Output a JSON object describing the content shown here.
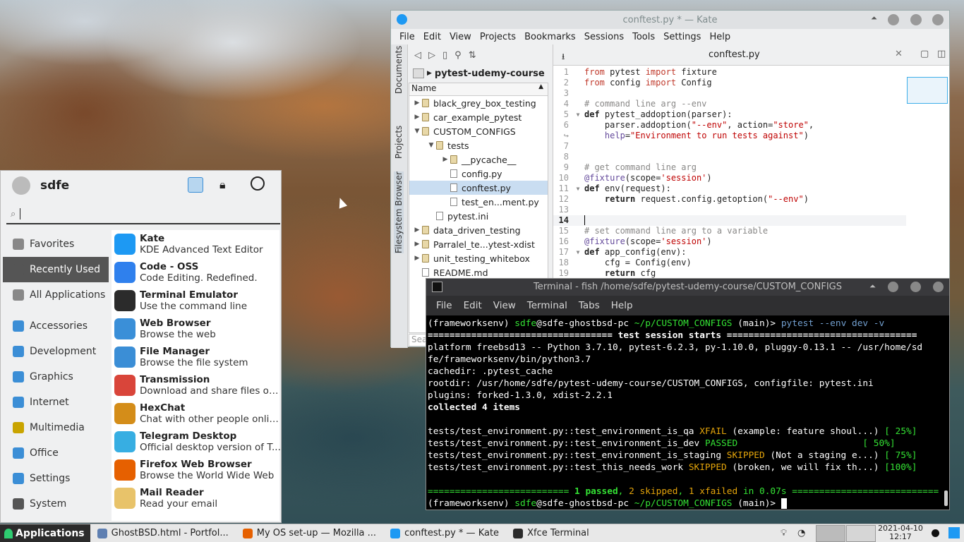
{
  "kate": {
    "title": "conftest.py * — Kate",
    "menu": [
      "File",
      "Edit",
      "View",
      "Projects",
      "Bookmarks",
      "Sessions",
      "Tools",
      "Settings",
      "Help"
    ],
    "side_tabs": [
      "Documents",
      "Projects",
      "Filesystem Browser"
    ],
    "crumb": "pytest-udemy-course",
    "tree_header": "Name",
    "tree": [
      {
        "label": "black_grey_box_testing",
        "type": "folder",
        "depth": 0,
        "arrow": "▶"
      },
      {
        "label": "car_example_pytest",
        "type": "folder",
        "depth": 0,
        "arrow": "▶"
      },
      {
        "label": "CUSTOM_CONFIGS",
        "type": "folder",
        "depth": 0,
        "arrow": "▼"
      },
      {
        "label": "tests",
        "type": "folder",
        "depth": 1,
        "arrow": "▼"
      },
      {
        "label": "__pycache__",
        "type": "folder",
        "depth": 2,
        "arrow": "▶"
      },
      {
        "label": "config.py",
        "type": "file",
        "depth": 2,
        "arrow": ""
      },
      {
        "label": "conftest.py",
        "type": "file",
        "depth": 2,
        "arrow": "",
        "selected": true
      },
      {
        "label": "test_en...ment.py",
        "type": "file",
        "depth": 2,
        "arrow": ""
      },
      {
        "label": "pytest.ini",
        "type": "file",
        "depth": 1,
        "arrow": ""
      },
      {
        "label": "data_driven_testing",
        "type": "folder",
        "depth": 0,
        "arrow": "▶"
      },
      {
        "label": "Parralel_te...ytest-xdist",
        "type": "folder",
        "depth": 0,
        "arrow": "▶"
      },
      {
        "label": "unit_testing_whitebox",
        "type": "folder",
        "depth": 0,
        "arrow": "▶"
      },
      {
        "label": "README.md",
        "type": "file",
        "depth": 0,
        "arrow": ""
      }
    ],
    "search_placeholder": "Sea",
    "tab": "conftest.py",
    "code_lines": [
      {
        "n": "1",
        "html": "<span class='k2'>from</span> pytest <span class='k2'>import</span> fixture"
      },
      {
        "n": "2",
        "html": "<span class='k2'>from</span> config <span class='k2'>import</span> Config"
      },
      {
        "n": "3",
        "html": ""
      },
      {
        "n": "4",
        "html": "<span class='cm'># command line arg --env</span>"
      },
      {
        "n": "5",
        "html": "<b>def</b> pytest_addoption(parser):",
        "fold": true
      },
      {
        "n": "6",
        "html": "    parser.addoption(<span class='st'>\"--env\"</span>, action=<span class='st'>\"store\"</span>,"
      },
      {
        "n": "↪",
        "html": "    <span class='hp'>help</span>=<span class='st'>\"Environment to run tests against\"</span>)"
      },
      {
        "n": "7",
        "html": ""
      },
      {
        "n": "8",
        "html": ""
      },
      {
        "n": "9",
        "html": "<span class='cm'># get command line arg</span>"
      },
      {
        "n": "10",
        "html": "<span class='dec'>@fixture</span>(scope=<span class='st'>'session'</span>)"
      },
      {
        "n": "11",
        "html": "<b>def</b> env(request):",
        "fold": true
      },
      {
        "n": "12",
        "html": "    <b>return</b> request.config.getoption(<span class='st'>\"--env\"</span>)"
      },
      {
        "n": "13",
        "html": ""
      },
      {
        "n": "14",
        "html": "",
        "cur": true
      },
      {
        "n": "15",
        "html": "<span class='cm'># set command line arg to a variable</span>"
      },
      {
        "n": "16",
        "html": "<span class='dec'>@fixture</span>(scope=<span class='st'>'session'</span>)"
      },
      {
        "n": "17",
        "html": "<b>def</b> app_config(env):",
        "fold": true
      },
      {
        "n": "18",
        "html": "    cfg = Config(env)"
      },
      {
        "n": "19",
        "html": "    <b>return</b> cfg"
      }
    ]
  },
  "terminal": {
    "title": "Terminal - fish /home/sdfe/pytest-udemy-course/CUSTOM_CONFIGS",
    "menu": [
      "File",
      "Edit",
      "View",
      "Terminal",
      "Tabs",
      "Help"
    ],
    "lines": [
      "<span class='w'>(frameworksenv) </span><span class='g'>sdfe</span>@sdfe-ghostbsd-pc <span class='g'>~/p/CUSTOM_CONFIGS</span> (main)&gt; <span class='bl'>pytest --env dev -v</span>",
      "<b>================================== test session starts ===================================</b>",
      "platform freebsd13 -- Python 3.7.10, pytest-6.2.3, py-1.10.0, pluggy-0.13.1 -- /usr/home/sd",
      "fe/frameworksenv/bin/python3.7",
      "cachedir: .pytest_cache",
      "rootdir: /usr/home/sdfe/pytest-udemy-course/CUSTOM_CONFIGS, configfile: pytest.ini",
      "plugins: forked-1.3.0, xdist-2.2.1",
      "<b>collected 4 items</b>",
      "",
      "tests/test_environment.py::test_environment_is_qa <span class='yo'>XFAIL</span> (example: feature shoul...) <span class='g'>[ 25%]</span>",
      "tests/test_environment.py::test_environment_is_dev <span class='g'>PASSED</span>                       <span class='g'>[ 50%]</span>",
      "tests/test_environment.py::test_environment_is_staging <span class='yo'>SKIPPED</span> (Not a staging e...) <span class='g'>[ 75%]</span>",
      "tests/test_environment.py::test_this_needs_work <span class='yo'>SKIPPED</span> (broken, we will fix th...) <span class='g'>[100%]</span>",
      "",
      "<span class='g'>========================== <b>1 passed</b>, </span><span class='yo'>2 skipped</span><span class='g'>, </span><span class='yo'>1 xfailed</span><span class='g'> in 0.07s ===========================</span>",
      "<span class='w'>(frameworksenv) </span><span class='g'>sdfe</span>@sdfe-ghostbsd-pc <span class='g'>~/p/CUSTOM_CONFIGS</span> (main)&gt; <span style='background:#fff'> </span>"
    ]
  },
  "appmenu": {
    "user": "sdfe",
    "search_placeholder": "",
    "categories": [
      {
        "label": "Favorites",
        "color": "#888"
      },
      {
        "label": "Recently Used",
        "color": "#555",
        "selected": true
      },
      {
        "label": "All Applications",
        "color": "#888"
      },
      {
        "label": "Accessories",
        "color": "#3b8ed6"
      },
      {
        "label": "Development",
        "color": "#3b8ed6"
      },
      {
        "label": "Graphics",
        "color": "#3b8ed6"
      },
      {
        "label": "Internet",
        "color": "#3b8ed6"
      },
      {
        "label": "Multimedia",
        "color": "#c9a400"
      },
      {
        "label": "Office",
        "color": "#3b8ed6"
      },
      {
        "label": "Settings",
        "color": "#3b8ed6"
      },
      {
        "label": "System",
        "color": "#555"
      }
    ],
    "apps": [
      {
        "name": "Kate",
        "desc": "KDE Advanced Text Editor",
        "color": "#1d99f3"
      },
      {
        "name": "Code - OSS",
        "desc": "Code Editing. Redefined.",
        "color": "#2f80ed"
      },
      {
        "name": "Terminal Emulator",
        "desc": "Use the command line",
        "color": "#2b2b2b"
      },
      {
        "name": "Web Browser",
        "desc": "Browse the web",
        "color": "#3a8fd8"
      },
      {
        "name": "File Manager",
        "desc": "Browse the file system",
        "color": "#3b8ed6"
      },
      {
        "name": "Transmission",
        "desc": "Download and share files ov...",
        "color": "#d9453a"
      },
      {
        "name": "HexChat",
        "desc": "Chat with other people online",
        "color": "#d48d19"
      },
      {
        "name": "Telegram Desktop",
        "desc": "Official desktop version of T...",
        "color": "#37aee2"
      },
      {
        "name": "Firefox Web Browser",
        "desc": "Browse the World Wide Web",
        "color": "#e66000"
      },
      {
        "name": "Mail Reader",
        "desc": "Read your email",
        "color": "#e8c36a"
      }
    ]
  },
  "taskbar": {
    "start": "Applications",
    "tasks": [
      {
        "label": "GhostBSD.html - Portfol...",
        "color": "#5e7fb1"
      },
      {
        "label": "My OS set-up — Mozilla ...",
        "color": "#e66000"
      },
      {
        "label": "conftest.py * — Kate",
        "color": "#1d99f3"
      },
      {
        "label": "Xfce Terminal",
        "color": "#2b2b2b"
      }
    ],
    "date": "2021-04-10",
    "time": "12:17"
  }
}
